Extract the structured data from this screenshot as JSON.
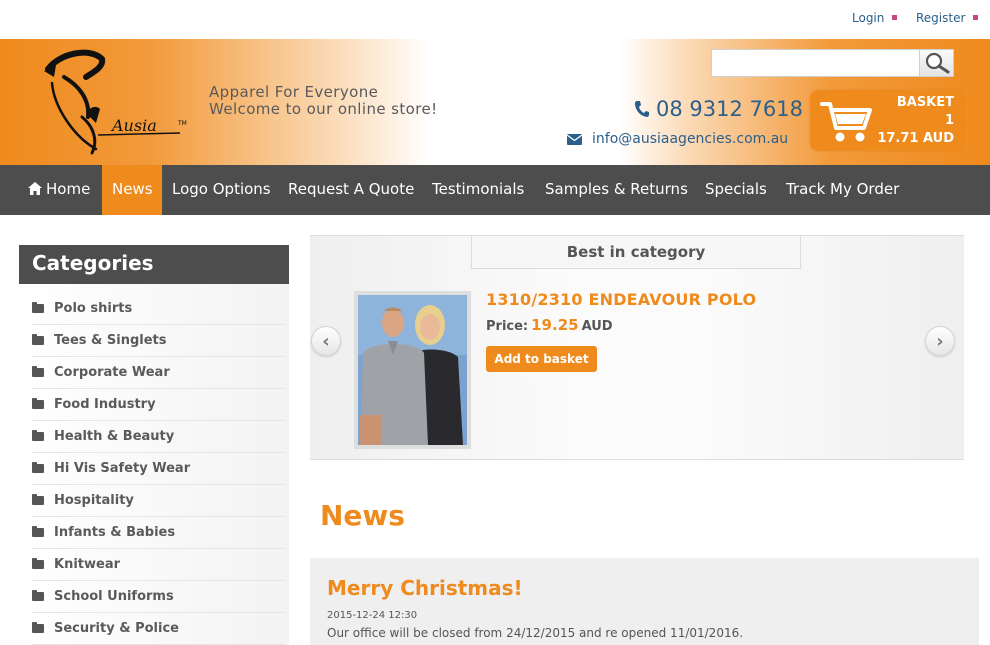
{
  "top_links": {
    "login": "Login",
    "register": "Register"
  },
  "header": {
    "logo_text": "Ausia",
    "tagline_1": "Apparel For Everyone",
    "tagline_2": "Welcome to our online store!",
    "search_placeholder": "",
    "phone": "08 9312 7618",
    "email": "info@ausiaagencies.com.au",
    "basket": {
      "label": "BASKET",
      "count": "1",
      "total": "17.71 AUD"
    }
  },
  "nav": {
    "items": [
      {
        "label": "Home",
        "icon": "home-icon"
      },
      {
        "label": "News"
      },
      {
        "label": "Logo Options"
      },
      {
        "label": "Request A Quote"
      },
      {
        "label": "Testimonials"
      },
      {
        "label": "Samples & Returns"
      },
      {
        "label": "Specials"
      },
      {
        "label": "Track My Order"
      }
    ],
    "active": "News"
  },
  "sidebar": {
    "title": "Categories",
    "items": [
      {
        "label": "Polo shirts"
      },
      {
        "label": "Tees & Singlets"
      },
      {
        "label": "Corporate Wear"
      },
      {
        "label": "Food Industry"
      },
      {
        "label": "Health & Beauty"
      },
      {
        "label": "Hi Vis Safety Wear"
      },
      {
        "label": "Hospitality"
      },
      {
        "label": "Infants & Babies"
      },
      {
        "label": "Knitwear"
      },
      {
        "label": "School Uniforms"
      },
      {
        "label": "Security & Police"
      }
    ]
  },
  "best": {
    "tab_label": "Best in category",
    "product": {
      "title": "1310/2310 ENDEAVOUR POLO",
      "price_label": "Price:",
      "price": "19.25",
      "currency": "AUD",
      "add_label": "Add to basket"
    }
  },
  "news": {
    "heading": "News",
    "post": {
      "title": "Merry Christmas!",
      "date": "2015-12-24 12:30",
      "body": "Our office will be closed from 24/12/2015 and re opened 11/01/2016."
    }
  },
  "colors": {
    "accent": "#ef8a1d",
    "nav_bg": "#4d4d4d",
    "link": "#2b5f8c"
  }
}
